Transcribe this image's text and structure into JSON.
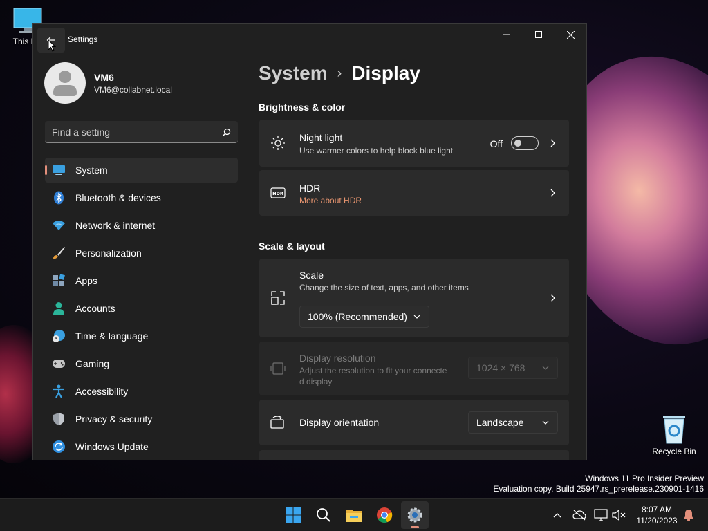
{
  "desktop": {
    "this_pc_label": "This PC",
    "recycle_bin_label": "Recycle Bin",
    "watermark_line1": "Windows 11 Pro Insider Preview",
    "watermark_line2": "Evaluation copy. Build 25947.rs_prerelease.230901-1416"
  },
  "window": {
    "title": "Settings",
    "back_icon": "back-arrow-icon",
    "controls": [
      "minimize",
      "maximize",
      "close"
    ]
  },
  "profile": {
    "name": "VM6",
    "email": "VM6@collabnet.local"
  },
  "search": {
    "placeholder": "Find a setting"
  },
  "nav": {
    "items": [
      {
        "label": "System",
        "icon": "system-icon",
        "active": true
      },
      {
        "label": "Bluetooth & devices",
        "icon": "bluetooth-icon"
      },
      {
        "label": "Network & internet",
        "icon": "wifi-icon"
      },
      {
        "label": "Personalization",
        "icon": "brush-icon"
      },
      {
        "label": "Apps",
        "icon": "apps-icon"
      },
      {
        "label": "Accounts",
        "icon": "person-icon"
      },
      {
        "label": "Time & language",
        "icon": "globe-clock-icon"
      },
      {
        "label": "Gaming",
        "icon": "gamepad-icon"
      },
      {
        "label": "Accessibility",
        "icon": "accessibility-icon"
      },
      {
        "label": "Privacy & security",
        "icon": "shield-icon"
      },
      {
        "label": "Windows Update",
        "icon": "update-icon"
      }
    ]
  },
  "breadcrumb": {
    "parent": "System",
    "separator": "›",
    "current": "Display"
  },
  "sections": {
    "brightness_title": "Brightness & color",
    "scale_title": "Scale & layout"
  },
  "night_light": {
    "title": "Night light",
    "subtitle": "Use warmer colors to help block blue light",
    "state": "Off"
  },
  "hdr": {
    "title": "HDR",
    "link": "More about HDR"
  },
  "scale": {
    "title": "Scale",
    "subtitle": "Change the size of text, apps, and other items",
    "value": "100% (Recommended)"
  },
  "resolution": {
    "title": "Display resolution",
    "subtitle_line1": "Adjust the resolution to fit your connecte",
    "subtitle_line2": "d display",
    "value": "1024 × 768"
  },
  "orientation": {
    "title": "Display orientation",
    "value": "Landscape"
  },
  "taskbar": {
    "apps": [
      "start-icon",
      "search-icon",
      "file-explorer-icon",
      "chrome-icon",
      "settings-icon"
    ],
    "time": "8:07 AM",
    "date": "11/20/2023"
  },
  "colors": {
    "accent": "#e38f7b",
    "link": "#e6946f",
    "window_bg": "#202020",
    "card_bg": "#2b2b2b"
  }
}
